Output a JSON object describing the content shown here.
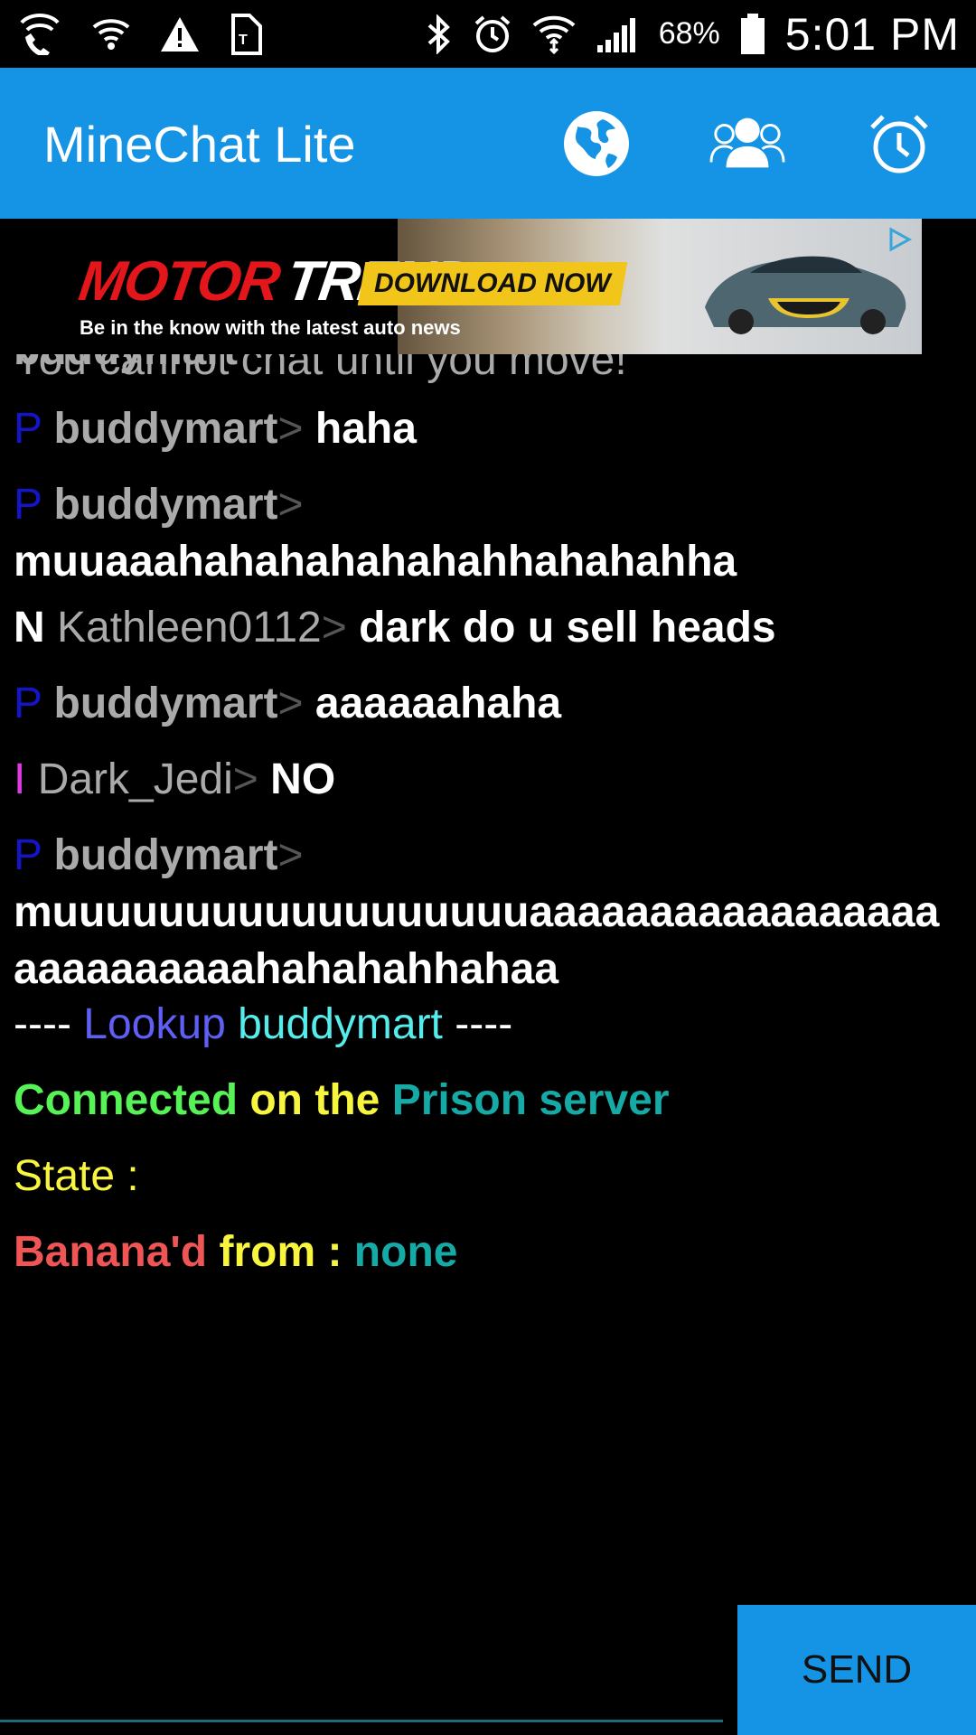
{
  "status_bar": {
    "battery_percent": "68%",
    "time": "5:01 PM",
    "icons": [
      "wifi-calling-icon",
      "wifi-icon",
      "warning-icon",
      "sim-icon",
      "bluetooth-icon",
      "alarm-icon",
      "wifi-signal-icon",
      "cell-signal-icon",
      "battery-icon"
    ]
  },
  "app_bar": {
    "title": "MineChat Lite",
    "actions": [
      "world-icon",
      "people-icon",
      "alarm-clock-icon"
    ],
    "color": "#1593e5"
  },
  "ad": {
    "brand_part1": "MOTOR",
    "brand_part2": "TREND",
    "tagline": "Be in the know with the latest auto news",
    "cta": "DOWNLOAD NOW",
    "adchoices_icon": "adchoices-icon"
  },
  "chat": {
    "notice": "You cannot chat until you move!",
    "messages": [
      {
        "rank": "P",
        "name": "buddymart",
        "sep": ">",
        "text": "haha"
      },
      {
        "rank": "P",
        "name": "buddymart",
        "sep": ">",
        "text": "muuaaahahahahahahahhahahahha"
      },
      {
        "rank": "N",
        "name": "Kathleen0112",
        "sep": ">",
        "text": "dark do u sell heads"
      },
      {
        "rank": "P",
        "name": "buddymart",
        "sep": ">",
        "text": "aaaaaahaha"
      },
      {
        "rank": "I",
        "name": "Dark_Jedi",
        "sep": ">",
        "text": "NO"
      },
      {
        "rank": "P",
        "name": "buddymart",
        "sep": ">",
        "text": "muuuuuuuuuuuuuuuuuuaaaaaaaaaaaaaaaaaaaaaaaaaaahahahahhahaa"
      }
    ],
    "lookup": {
      "dashes_left": "----",
      "label": "Lookup",
      "name": "buddymart",
      "dashes_right": "----"
    },
    "connected": {
      "part1": "Connected",
      "part2": "on the",
      "part3": "Prison server"
    },
    "state": {
      "label": "State :"
    },
    "banana": {
      "part1": "Banana'd",
      "part2": "from :",
      "part3": "none"
    }
  },
  "input": {
    "send_label": "SEND"
  }
}
